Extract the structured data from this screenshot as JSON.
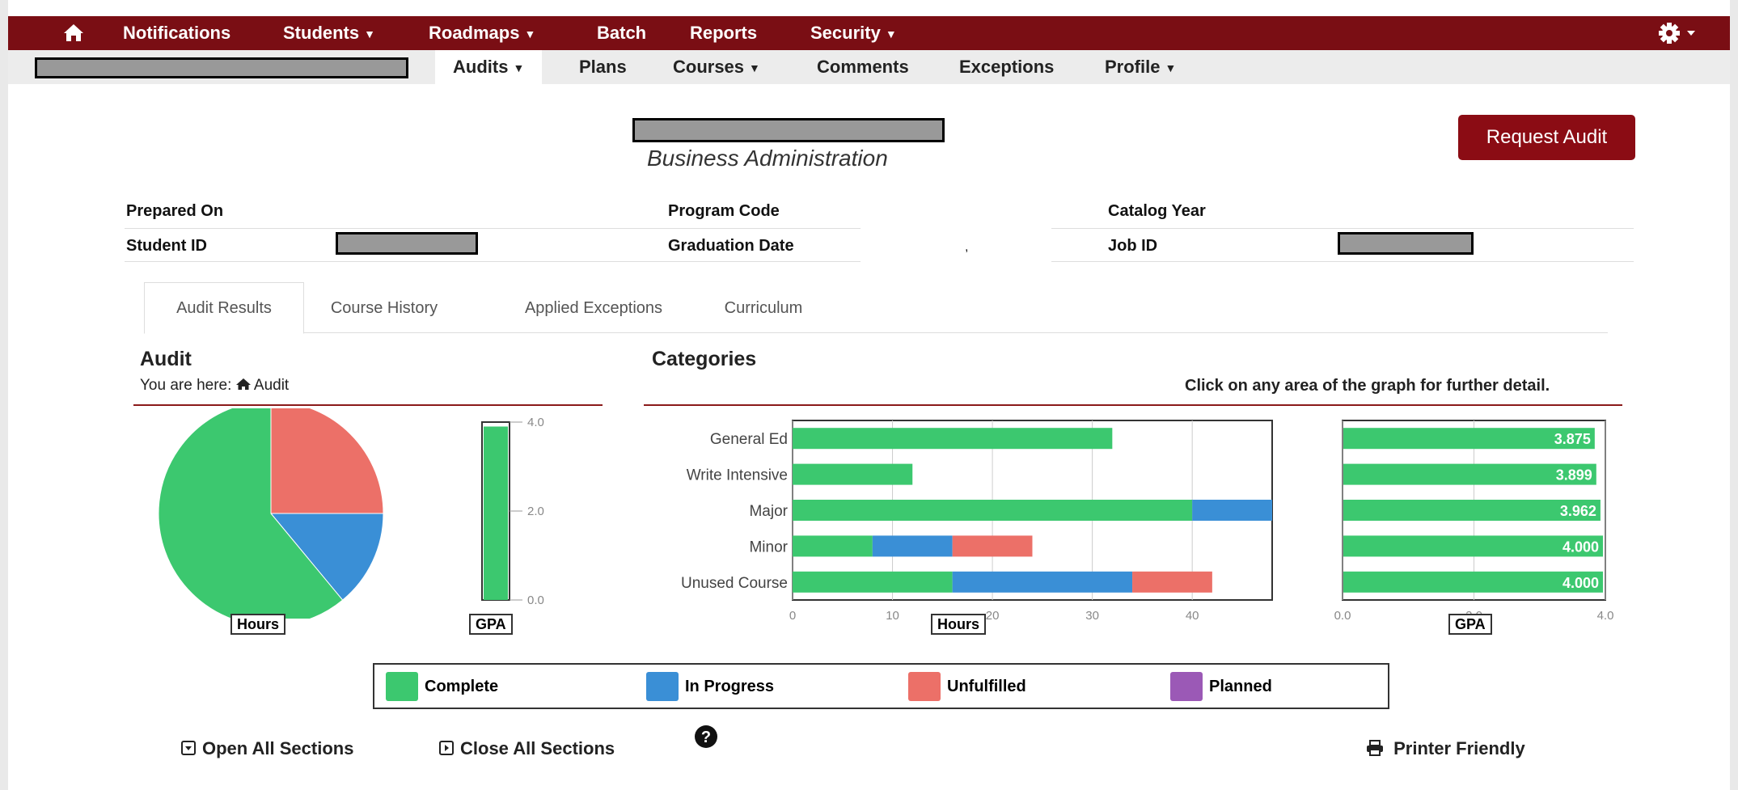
{
  "topnav": {
    "items": [
      "Notifications",
      "Students",
      "Roadmaps",
      "Batch",
      "Reports",
      "Security"
    ]
  },
  "subnav": {
    "items": [
      "Audits",
      "Plans",
      "Courses",
      "Comments",
      "Exceptions",
      "Profile"
    ]
  },
  "header": {
    "program_name": "Business Administration",
    "request_button": "Request Audit"
  },
  "info": {
    "prepared_on_label": "Prepared On",
    "student_id_label": "Student ID",
    "program_code_label": "Program Code",
    "graduation_date_label": "Graduation Date",
    "graduation_date_value": ",",
    "catalog_year_label": "Catalog Year",
    "job_id_label": "Job ID"
  },
  "tabs": [
    "Audit Results",
    "Course History",
    "Applied Exceptions",
    "Curriculum"
  ],
  "audit": {
    "title": "Audit",
    "breadcrumb_prefix": "You are here:",
    "breadcrumb_item": "Audit"
  },
  "categories": {
    "title": "Categories",
    "hint": "Click on any area of the graph for further detail."
  },
  "legend": {
    "complete": "Complete",
    "in_progress": "In Progress",
    "unfulfilled": "Unfulfilled",
    "planned": "Planned"
  },
  "footer": {
    "open_all": "Open All Sections",
    "close_all": "Close All Sections",
    "printer": "Printer Friendly"
  },
  "colors": {
    "complete": "#3cc86f",
    "in_progress": "#3a8fd6",
    "unfulfilled": "#ec7068",
    "planned": "#9b59b6",
    "brand": "#7a0e14"
  },
  "chart_data": [
    {
      "type": "pie",
      "xlabel": "Hours",
      "slices": [
        {
          "name": "Complete",
          "value": 61
        },
        {
          "name": "In Progress",
          "value": 14
        },
        {
          "name": "Unfulfilled",
          "value": 25
        }
      ]
    },
    {
      "type": "bar",
      "xlabel": "GPA",
      "ylim": [
        0,
        4
      ],
      "ticks": [
        "0.0",
        "2.0",
        "4.0"
      ],
      "values": [
        3.9
      ]
    },
    {
      "type": "bar",
      "orientation": "horizontal",
      "stacked": true,
      "xlabel": "Hours",
      "xlim": [
        0,
        48
      ],
      "ticks": [
        "0",
        "10",
        "20",
        "30",
        "40"
      ],
      "categories": [
        "General Ed",
        "Write Intensive",
        "Major",
        "Minor",
        "Unused Course"
      ],
      "series": [
        {
          "name": "Complete",
          "values": [
            32,
            12,
            40,
            8,
            16
          ]
        },
        {
          "name": "In Progress",
          "values": [
            0,
            0,
            8,
            8,
            18
          ]
        },
        {
          "name": "Unfulfilled",
          "values": [
            0,
            0,
            0,
            8,
            8
          ]
        }
      ]
    },
    {
      "type": "bar",
      "orientation": "horizontal",
      "xlabel": "GPA",
      "xlim": [
        0,
        4
      ],
      "ticks": [
        "0.0",
        "2.0",
        "4.0"
      ],
      "categories": [
        "General Ed",
        "Write Intensive",
        "Major",
        "Minor",
        "Unused Course"
      ],
      "values": [
        3.875,
        3.899,
        3.962,
        4.0,
        4.0
      ],
      "data_labels": [
        "3.875",
        "3.899",
        "3.962",
        "4.000",
        "4.000"
      ]
    }
  ]
}
